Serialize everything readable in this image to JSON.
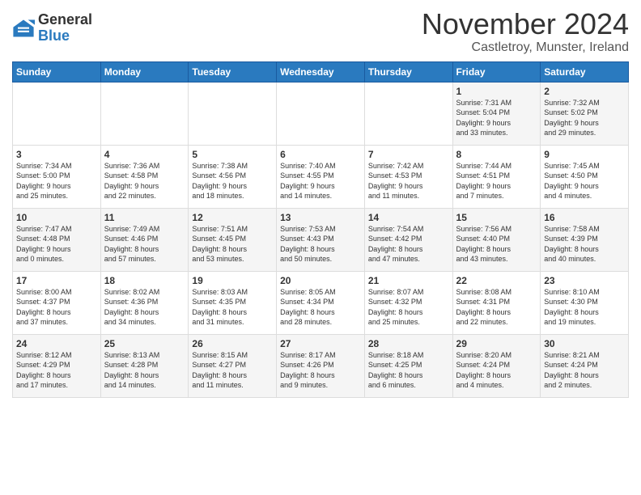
{
  "header": {
    "logo_general": "General",
    "logo_blue": "Blue",
    "month_title": "November 2024",
    "subtitle": "Castletroy, Munster, Ireland"
  },
  "columns": [
    "Sunday",
    "Monday",
    "Tuesday",
    "Wednesday",
    "Thursday",
    "Friday",
    "Saturday"
  ],
  "weeks": [
    [
      {
        "day": "",
        "info": ""
      },
      {
        "day": "",
        "info": ""
      },
      {
        "day": "",
        "info": ""
      },
      {
        "day": "",
        "info": ""
      },
      {
        "day": "",
        "info": ""
      },
      {
        "day": "1",
        "info": "Sunrise: 7:31 AM\nSunset: 5:04 PM\nDaylight: 9 hours\nand 33 minutes."
      },
      {
        "day": "2",
        "info": "Sunrise: 7:32 AM\nSunset: 5:02 PM\nDaylight: 9 hours\nand 29 minutes."
      }
    ],
    [
      {
        "day": "3",
        "info": "Sunrise: 7:34 AM\nSunset: 5:00 PM\nDaylight: 9 hours\nand 25 minutes."
      },
      {
        "day": "4",
        "info": "Sunrise: 7:36 AM\nSunset: 4:58 PM\nDaylight: 9 hours\nand 22 minutes."
      },
      {
        "day": "5",
        "info": "Sunrise: 7:38 AM\nSunset: 4:56 PM\nDaylight: 9 hours\nand 18 minutes."
      },
      {
        "day": "6",
        "info": "Sunrise: 7:40 AM\nSunset: 4:55 PM\nDaylight: 9 hours\nand 14 minutes."
      },
      {
        "day": "7",
        "info": "Sunrise: 7:42 AM\nSunset: 4:53 PM\nDaylight: 9 hours\nand 11 minutes."
      },
      {
        "day": "8",
        "info": "Sunrise: 7:44 AM\nSunset: 4:51 PM\nDaylight: 9 hours\nand 7 minutes."
      },
      {
        "day": "9",
        "info": "Sunrise: 7:45 AM\nSunset: 4:50 PM\nDaylight: 9 hours\nand 4 minutes."
      }
    ],
    [
      {
        "day": "10",
        "info": "Sunrise: 7:47 AM\nSunset: 4:48 PM\nDaylight: 9 hours\nand 0 minutes."
      },
      {
        "day": "11",
        "info": "Sunrise: 7:49 AM\nSunset: 4:46 PM\nDaylight: 8 hours\nand 57 minutes."
      },
      {
        "day": "12",
        "info": "Sunrise: 7:51 AM\nSunset: 4:45 PM\nDaylight: 8 hours\nand 53 minutes."
      },
      {
        "day": "13",
        "info": "Sunrise: 7:53 AM\nSunset: 4:43 PM\nDaylight: 8 hours\nand 50 minutes."
      },
      {
        "day": "14",
        "info": "Sunrise: 7:54 AM\nSunset: 4:42 PM\nDaylight: 8 hours\nand 47 minutes."
      },
      {
        "day": "15",
        "info": "Sunrise: 7:56 AM\nSunset: 4:40 PM\nDaylight: 8 hours\nand 43 minutes."
      },
      {
        "day": "16",
        "info": "Sunrise: 7:58 AM\nSunset: 4:39 PM\nDaylight: 8 hours\nand 40 minutes."
      }
    ],
    [
      {
        "day": "17",
        "info": "Sunrise: 8:00 AM\nSunset: 4:37 PM\nDaylight: 8 hours\nand 37 minutes."
      },
      {
        "day": "18",
        "info": "Sunrise: 8:02 AM\nSunset: 4:36 PM\nDaylight: 8 hours\nand 34 minutes."
      },
      {
        "day": "19",
        "info": "Sunrise: 8:03 AM\nSunset: 4:35 PM\nDaylight: 8 hours\nand 31 minutes."
      },
      {
        "day": "20",
        "info": "Sunrise: 8:05 AM\nSunset: 4:34 PM\nDaylight: 8 hours\nand 28 minutes."
      },
      {
        "day": "21",
        "info": "Sunrise: 8:07 AM\nSunset: 4:32 PM\nDaylight: 8 hours\nand 25 minutes."
      },
      {
        "day": "22",
        "info": "Sunrise: 8:08 AM\nSunset: 4:31 PM\nDaylight: 8 hours\nand 22 minutes."
      },
      {
        "day": "23",
        "info": "Sunrise: 8:10 AM\nSunset: 4:30 PM\nDaylight: 8 hours\nand 19 minutes."
      }
    ],
    [
      {
        "day": "24",
        "info": "Sunrise: 8:12 AM\nSunset: 4:29 PM\nDaylight: 8 hours\nand 17 minutes."
      },
      {
        "day": "25",
        "info": "Sunrise: 8:13 AM\nSunset: 4:28 PM\nDaylight: 8 hours\nand 14 minutes."
      },
      {
        "day": "26",
        "info": "Sunrise: 8:15 AM\nSunset: 4:27 PM\nDaylight: 8 hours\nand 11 minutes."
      },
      {
        "day": "27",
        "info": "Sunrise: 8:17 AM\nSunset: 4:26 PM\nDaylight: 8 hours\nand 9 minutes."
      },
      {
        "day": "28",
        "info": "Sunrise: 8:18 AM\nSunset: 4:25 PM\nDaylight: 8 hours\nand 6 minutes."
      },
      {
        "day": "29",
        "info": "Sunrise: 8:20 AM\nSunset: 4:24 PM\nDaylight: 8 hours\nand 4 minutes."
      },
      {
        "day": "30",
        "info": "Sunrise: 8:21 AM\nSunset: 4:24 PM\nDaylight: 8 hours\nand 2 minutes."
      }
    ]
  ]
}
